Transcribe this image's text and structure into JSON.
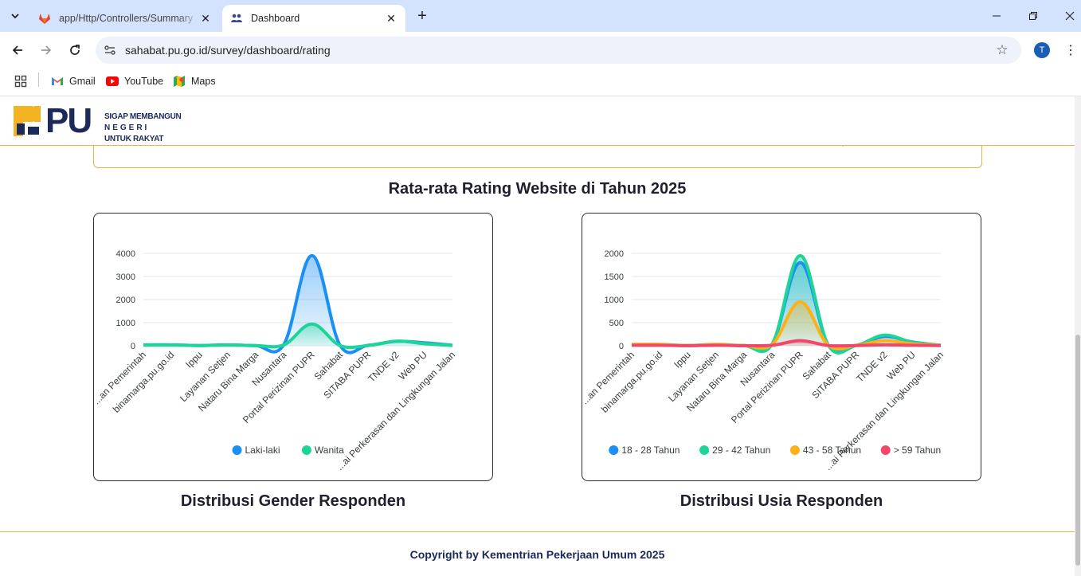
{
  "browser": {
    "tabs": [
      {
        "title": "app/Http/Controllers/Summary",
        "active": false,
        "favicon": "gitlab-icon"
      },
      {
        "title": "Dashboard",
        "active": true,
        "favicon": "users-icon"
      }
    ],
    "url": "sahabat.pu.go.id/survey/dashboard/rating",
    "profile_initial": "T",
    "bookmarks": [
      {
        "label": "Gmail",
        "icon": "gmail-icon"
      },
      {
        "label": "YouTube",
        "icon": "youtube-icon"
      },
      {
        "label": "Maps",
        "icon": "maps-icon"
      }
    ]
  },
  "header": {
    "logo_mark": "PU",
    "logo_line1": "SIGAP MEMBANGUN",
    "logo_line2": "NEGERI",
    "logo_line3": "UNTUK RAKYAT"
  },
  "main": {
    "section_title": "Rata-rata Rating Website di Tahun 2025",
    "gender_caption": "Distribusi Gender Responden",
    "age_caption": "Distribusi Usia Responden"
  },
  "footer": {
    "copyright": "Copyright by Kementrian Pekerjaan Umum 2025"
  },
  "colors": {
    "blue": "#1a8ff5",
    "green": "#1dd598",
    "orange": "#feb019",
    "red": "#f0476b",
    "gold_border": "#e0b94a",
    "navy": "#1b2a5b"
  },
  "chart_data": [
    {
      "type": "area",
      "categories": [
        "...an Pemerintah",
        "binamarga.pu.go.id",
        "Ippu",
        "Layanan Setjen",
        "Nataru Bina Marga",
        "Nusantara",
        "Portal Perizinan PUPR",
        "Sahabat",
        "SITABA PUPR",
        "TNDE v2",
        "Web PU",
        "...ai Perkerasan dan Lingkungan Jalan"
      ],
      "ylim": [
        0,
        4000
      ],
      "yticks": [
        0,
        1000,
        2000,
        3000,
        4000
      ],
      "legend_position": "bottom",
      "grid": true,
      "series": [
        {
          "name": "Laki-laki",
          "color": "#1a8ff5",
          "values": [
            40,
            40,
            10,
            40,
            10,
            60,
            3900,
            20,
            20,
            190,
            130,
            20
          ]
        },
        {
          "name": "Wanita",
          "color": "#1dd598",
          "values": [
            30,
            30,
            10,
            30,
            10,
            40,
            940,
            10,
            10,
            200,
            90,
            10
          ]
        }
      ]
    },
    {
      "type": "area",
      "categories": [
        "...an Pemerintah",
        "binamarga.pu.go.id",
        "Ippu",
        "Layanan Setjen",
        "Nataru Bina Marga",
        "Nusantara",
        "Portal Perizinan PUPR",
        "Sahabat",
        "SITABA PUPR",
        "TNDE v2",
        "Web PU",
        "...ai Perkerasan dan Lingkungan Jalan"
      ],
      "ylim": [
        0,
        2000
      ],
      "yticks": [
        0,
        500,
        1000,
        1500,
        2000
      ],
      "legend_position": "bottom",
      "grid": true,
      "series": [
        {
          "name": "18 - 28 Tahun",
          "color": "#1a8ff5",
          "values": [
            20,
            20,
            5,
            20,
            5,
            40,
            1800,
            10,
            10,
            200,
            80,
            10
          ]
        },
        {
          "name": "29 - 42 Tahun",
          "color": "#1dd598",
          "values": [
            25,
            25,
            5,
            25,
            5,
            40,
            1950,
            10,
            10,
            230,
            70,
            10
          ]
        },
        {
          "name": "43 - 58 Tahun",
          "color": "#feb019",
          "values": [
            30,
            30,
            5,
            30,
            5,
            30,
            950,
            10,
            10,
            110,
            40,
            10
          ]
        },
        {
          "name": "> 59 Tahun",
          "color": "#f0476b",
          "values": [
            10,
            10,
            2,
            10,
            2,
            10,
            110,
            5,
            5,
            20,
            10,
            5
          ]
        }
      ]
    }
  ]
}
